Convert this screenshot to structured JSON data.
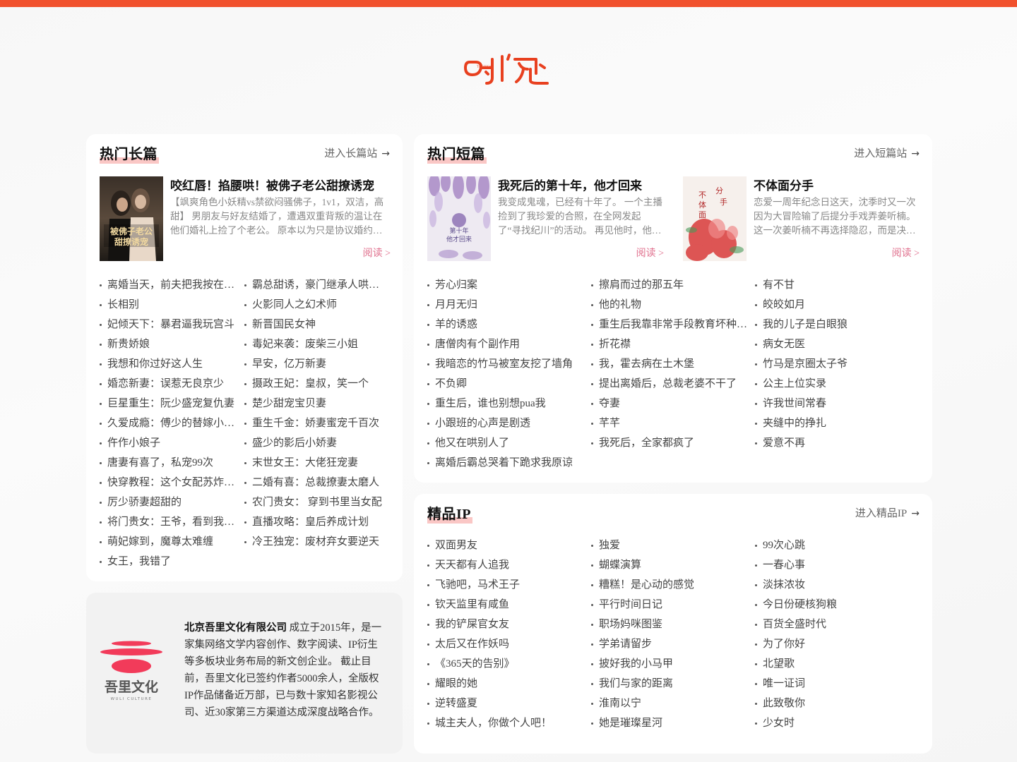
{
  "colors": {
    "accent": "#f1512d",
    "read_link": "#e0708e",
    "title_highlight": "#f8b4b2"
  },
  "brand": {
    "logo_text": "时阅"
  },
  "long": {
    "title": "热门长篇",
    "enter": "进入长篇站",
    "featured": {
      "title": "咬红唇！掐腰哄！被佛子老公甜撩诱宠",
      "desc": "【飒爽角色小妖精vs禁欲闷骚佛子，1v1，双洁，高甜】 男朋友与好友结婚了，遭遇双重背叛的温让在他们婚礼上捡了个老公。 原本以为只是协议婚约，约定期满就离婚，谁知……",
      "read": "阅读 >"
    },
    "items": [
      "离婚当天，前夫把我按在民政局",
      "霸总甜诱，豪门继承人哄我入怀",
      "长相别",
      "火影同人之幻术师",
      "妃倾天下：暴君逼我玩宫斗",
      "新晋国民女神",
      "新贵娇娘",
      "毒妃来袭：废柴三小姐",
      "我想和你过好这人生",
      "早安，亿万新妻",
      "婚恋新妻：误惹无良京少",
      "摄政王妃：皇叔，笑一个",
      "巨星重生：阮少盛宠复仇妻",
      "楚少甜宠宝贝妻",
      "久爱成瘾：傅少的替嫁小娇妻",
      "重生千金：娇妻蜜宠千百次",
      "仵作小娘子",
      "盛少的影后小娇妻",
      "唐妻有喜了，私宠99次",
      "末世女王：大佬狂宠妻",
      "快穿教程：这个女配苏炸了！",
      "二婚有喜：总裁撩妻太磨人",
      "厉少骄妻超甜的",
      "农门贵女： 穿到书里当女配",
      "将门贵女：王爷，看到我刀了吗",
      "直播攻略：皇后养成计划",
      "萌妃嫁到，魔尊太难缠",
      "冷王独宠：废材弃女要逆天",
      "女王，我错了"
    ]
  },
  "short": {
    "title": "热门短篇",
    "enter": "进入短篇站",
    "featured": [
      {
        "title": "我死后的第十年，他才回来",
        "desc": "我变成鬼魂，已经有十年了。 一个主播捡到了我珍爱的合照，在全网发起了“寻找纪川”的活动。 再见他时，他已经要订婚了……",
        "read": "阅读 >"
      },
      {
        "title": "不体面分手",
        "desc": "恋爱一周年纪念日这天，沈季时又一次因为大冒险输了后提分手戏弄姜听楠。这一次姜听楠不再选择隐忍，而是决定结束这段感情……",
        "read": "阅读 >"
      }
    ],
    "col1": [
      "芳心归案",
      "月月无归",
      "羊的诱惑",
      "唐僧肉有个副作用",
      "我暗恋的竹马被室友挖了墙角",
      "不负卿",
      "重生后，谁也别想pua我",
      "小跟班的心声是剧透",
      "他又在哄别人了",
      "离婚后霸总哭着下跪求我原谅"
    ],
    "col2": [
      "擦肩而过的那五年",
      "他的礼物",
      "重生后我靠非常手段教育坏种儿子",
      "折花襟",
      "我，霍去病在土木堡",
      "提出离婚后，总裁老婆不干了",
      "夺妻",
      "芊芊",
      "我死后，全家都疯了"
    ],
    "col3": [
      "有不甘",
      "皎皎如月",
      "我的儿子是白眼狼",
      "病女无医",
      "竹马是京圈太子爷",
      "公主上位实录",
      "许我世间常春",
      "夹缝中的挣扎",
      "爱意不再"
    ]
  },
  "ip": {
    "title": "精品IP",
    "enter": "进入精品IP",
    "col1": [
      "双面男友",
      "天天都有人追我",
      "飞驰吧，马术王子",
      "钦天监里有咸鱼",
      "我的铲屎官女友",
      "太后又在作妖吗",
      "《365天的告别》",
      "耀眼的她",
      "逆转盛夏",
      "城主夫人，你做个人吧！"
    ],
    "col2": [
      "独爱",
      "蝴蝶演算",
      "糟糕！是心动的感觉",
      "平行时间日记",
      "职场妈咪图鉴",
      "学弟请留步",
      "披好我的小马甲",
      "我们与家的距离",
      "淮南以宁",
      "她是璀璨星河"
    ],
    "col3": [
      "99次心跳",
      "一春心事",
      "淡抹浓妆",
      "今日份硬核狗粮",
      "百货全盛时代",
      "为了你好",
      "北望歌",
      "唯一证词",
      "此致敬你",
      "少女时"
    ]
  },
  "company": {
    "name": "北京吾里文化有限公司",
    "desc": " 成立于2015年，是一家集网络文学内容创作、数字阅读、IP衍生等多板块业务布局的新文创企业。 截止目前，吾里文化已签约作者5000余人，全版权IP作品储备近万部，已与数十家知名影视公司、近30家第三方渠道达成深度战略合作。",
    "logo_name": "吾里文化",
    "logo_sub": "WULI CULTURE"
  }
}
